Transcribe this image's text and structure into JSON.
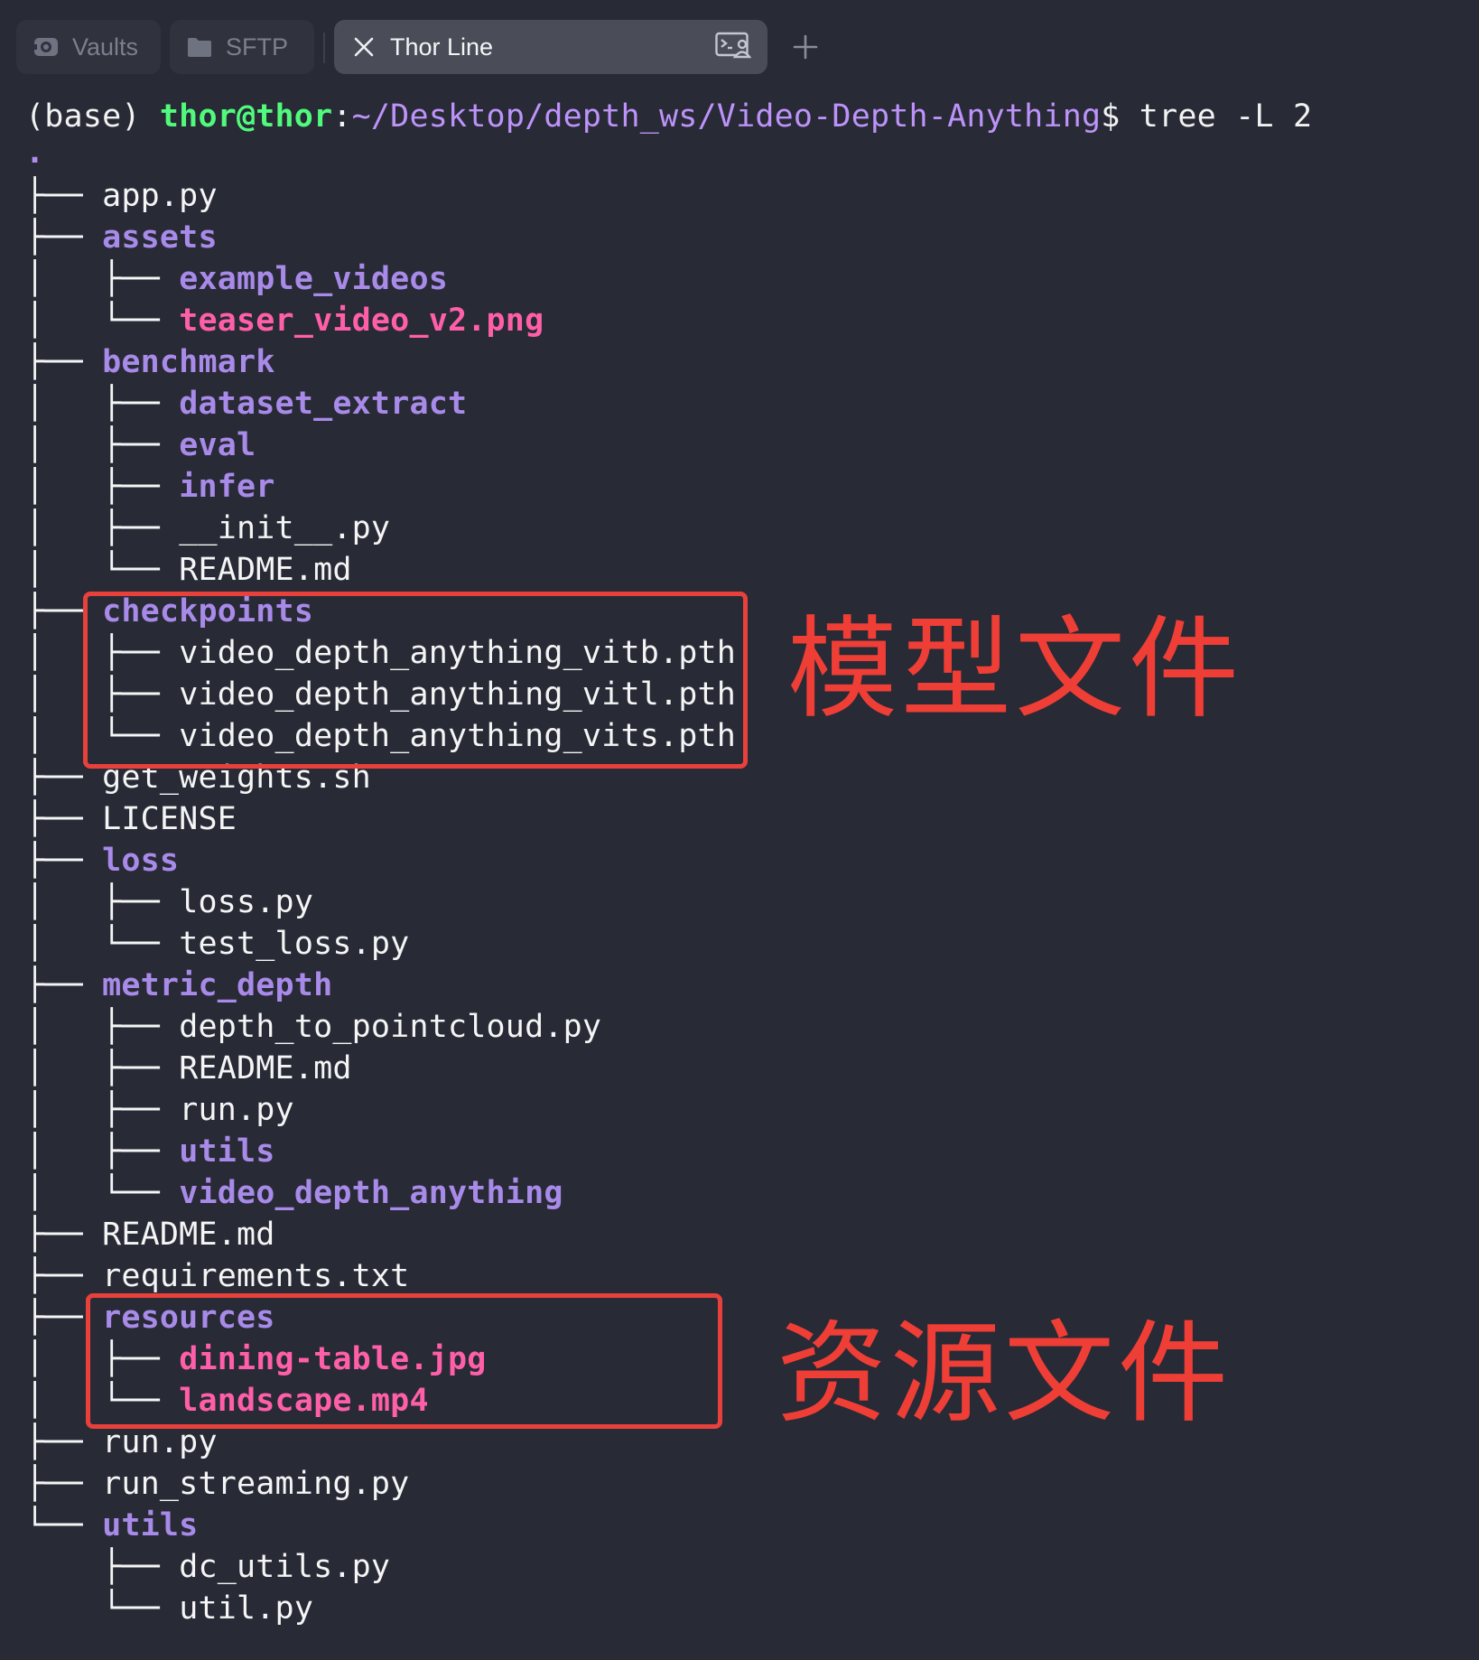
{
  "tabs": [
    {
      "label": "Vaults",
      "icon": "vault-icon"
    },
    {
      "label": "SFTP",
      "icon": "folder-icon"
    },
    {
      "label": "Thor Line",
      "icon": "close-icon",
      "active": true
    }
  ],
  "prompt": {
    "env": "(base) ",
    "user_host": "thor@thor",
    "sep": ":",
    "path": "~/Desktop/depth_ws/Video-Depth-Anything",
    "dollar": "$",
    "command": " tree -L 2"
  },
  "tree_root": ".",
  "tree": [
    {
      "prefix": "├── ",
      "name": "app.py",
      "kind": "file"
    },
    {
      "prefix": "├── ",
      "name": "assets",
      "kind": "dir"
    },
    {
      "prefix": "│   ├── ",
      "name": "example_videos",
      "kind": "dir"
    },
    {
      "prefix": "│   └── ",
      "name": "teaser_video_v2.png",
      "kind": "media"
    },
    {
      "prefix": "├── ",
      "name": "benchmark",
      "kind": "dir"
    },
    {
      "prefix": "│   ├── ",
      "name": "dataset_extract",
      "kind": "dir"
    },
    {
      "prefix": "│   ├── ",
      "name": "eval",
      "kind": "dir"
    },
    {
      "prefix": "│   ├── ",
      "name": "infer",
      "kind": "dir"
    },
    {
      "prefix": "│   ├── ",
      "name": "__init__.py",
      "kind": "file"
    },
    {
      "prefix": "│   └── ",
      "name": "README.md",
      "kind": "file"
    },
    {
      "prefix": "├── ",
      "name": "checkpoints",
      "kind": "dir"
    },
    {
      "prefix": "│   ├── ",
      "name": "video_depth_anything_vitb.pth",
      "kind": "file"
    },
    {
      "prefix": "│   ├── ",
      "name": "video_depth_anything_vitl.pth",
      "kind": "file"
    },
    {
      "prefix": "│   └── ",
      "name": "video_depth_anything_vits.pth",
      "kind": "file"
    },
    {
      "prefix": "├── ",
      "name": "get_weights.sh",
      "kind": "file"
    },
    {
      "prefix": "├── ",
      "name": "LICENSE",
      "kind": "file"
    },
    {
      "prefix": "├── ",
      "name": "loss",
      "kind": "dir"
    },
    {
      "prefix": "│   ├── ",
      "name": "loss.py",
      "kind": "file"
    },
    {
      "prefix": "│   └── ",
      "name": "test_loss.py",
      "kind": "file"
    },
    {
      "prefix": "├── ",
      "name": "metric_depth",
      "kind": "dir"
    },
    {
      "prefix": "│   ├── ",
      "name": "depth_to_pointcloud.py",
      "kind": "file"
    },
    {
      "prefix": "│   ├── ",
      "name": "README.md",
      "kind": "file"
    },
    {
      "prefix": "│   ├── ",
      "name": "run.py",
      "kind": "file"
    },
    {
      "prefix": "│   ├── ",
      "name": "utils",
      "kind": "dir"
    },
    {
      "prefix": "│   └── ",
      "name": "video_depth_anything",
      "kind": "dir"
    },
    {
      "prefix": "├── ",
      "name": "README.md",
      "kind": "file"
    },
    {
      "prefix": "├── ",
      "name": "requirements.txt",
      "kind": "file"
    },
    {
      "prefix": "├── ",
      "name": "resources",
      "kind": "dir"
    },
    {
      "prefix": "│   ├── ",
      "name": "dining-table.jpg",
      "kind": "media"
    },
    {
      "prefix": "│   └── ",
      "name": "landscape.mp4",
      "kind": "media"
    },
    {
      "prefix": "├── ",
      "name": "run.py",
      "kind": "file"
    },
    {
      "prefix": "├── ",
      "name": "run_streaming.py",
      "kind": "file"
    },
    {
      "prefix": "└── ",
      "name": "utils",
      "kind": "dir"
    },
    {
      "prefix": "    ├── ",
      "name": "dc_utils.py",
      "kind": "file"
    },
    {
      "prefix": "    └── ",
      "name": "util.py",
      "kind": "file"
    }
  ],
  "annotations": [
    {
      "label": "模型文件",
      "color": "#e8413b"
    },
    {
      "label": "资源文件",
      "color": "#e8413b"
    }
  ],
  "colors": {
    "background": "#282a36",
    "prompt_user": "#50fa7b",
    "prompt_path": "#bd93f9",
    "directory": "#a88ae8",
    "media": "#ff5fa8",
    "annotation": "#e8413b"
  }
}
